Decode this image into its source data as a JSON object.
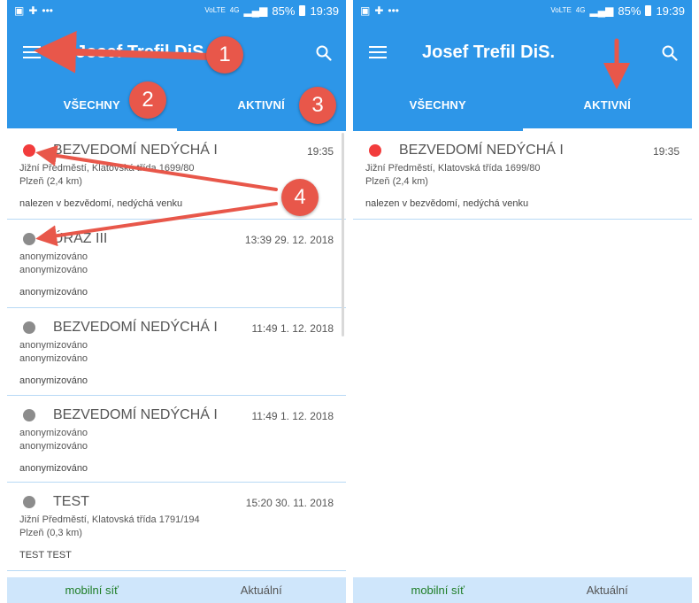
{
  "colors": {
    "primary": "#2d96e8",
    "active_dot": "#f23c3c",
    "inactive_dot": "#8c8c8c",
    "annotation": "#e8574a",
    "bottom_bar": "#cfe6fb",
    "network_green": "#1e7d26"
  },
  "left_screen": {
    "status": {
      "battery": "85%",
      "time": "19:39",
      "network": "4G"
    },
    "app_title": "Josef Trefil DiS.",
    "tabs": {
      "all_label": "VŠECHNY",
      "active_label": "AKTIVNÍ"
    },
    "items": [
      {
        "title": "BEZVEDOMÍ NEDÝCHÁ I",
        "time": "19:35",
        "line1": "Jižní Předměstí, Klatovská třída 1699/80",
        "line2": "Plzeň (2,4 km)",
        "note": "nalezen v bezvědomí, nedýchá venku",
        "dot": "red"
      },
      {
        "title": "ÚRAZ III",
        "time": "13:39 29. 12. 2018",
        "line1": "anonymizováno",
        "line2": "anonymizováno",
        "note": "anonymizováno",
        "dot": "gray"
      },
      {
        "title": "BEZVEDOMÍ NEDÝCHÁ I",
        "time": "11:49 1. 12. 2018",
        "line1": "anonymizováno",
        "line2": "anonymizováno",
        "note": "anonymizováno",
        "dot": "gray"
      },
      {
        "title": "BEZVEDOMÍ NEDÝCHÁ I",
        "time": "11:49 1. 12. 2018",
        "line1": "anonymizováno",
        "line2": "anonymizováno",
        "note": "anonymizováno",
        "dot": "gray"
      },
      {
        "title": "TEST",
        "time": "15:20 30. 11. 2018",
        "line1": "Jižní Předměstí, Klatovská třída 1791/194",
        "line2": "Plzeň (0,3 km)",
        "note": "TEST TEST",
        "dot": "gray"
      }
    ],
    "bottom": {
      "left": "mobilní síť",
      "right": "Aktuální"
    }
  },
  "right_screen": {
    "status": {
      "battery": "85%",
      "time": "19:39",
      "network": "4G"
    },
    "app_title": "Josef Trefil DiS.",
    "tabs": {
      "all_label": "VŠECHNY",
      "active_label": "AKTIVNÍ"
    },
    "items": [
      {
        "title": "BEZVEDOMÍ NEDÝCHÁ I",
        "time": "19:35",
        "line1": "Jižní Předměstí, Klatovská třída 1699/80",
        "line2": "Plzeň (2,4 km)",
        "note": "nalezen v bezvědomí, nedýchá venku",
        "dot": "red"
      }
    ],
    "bottom": {
      "left": "mobilní síť",
      "right": "Aktuální"
    }
  },
  "annotations": {
    "badge1": "1",
    "badge2": "2",
    "badge3": "3",
    "badge4": "4"
  }
}
